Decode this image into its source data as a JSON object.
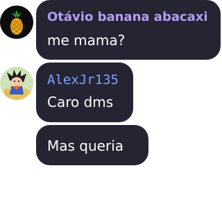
{
  "messages": [
    {
      "sender": "Otávio banana abacaxi",
      "sender_color": "#b39cf5",
      "text": "me mama?",
      "avatar": "pineapple-avatar"
    },
    {
      "sender": "AlexJr135",
      "sender_color": "#7fa2ff",
      "text": "Caro dms",
      "avatar": "anime-character-avatar"
    },
    {
      "text": "Mas queria"
    }
  ],
  "colors": {
    "bubble_bg": "#252433",
    "message_text": "#ffffff",
    "page_bg": "#ffffff"
  }
}
